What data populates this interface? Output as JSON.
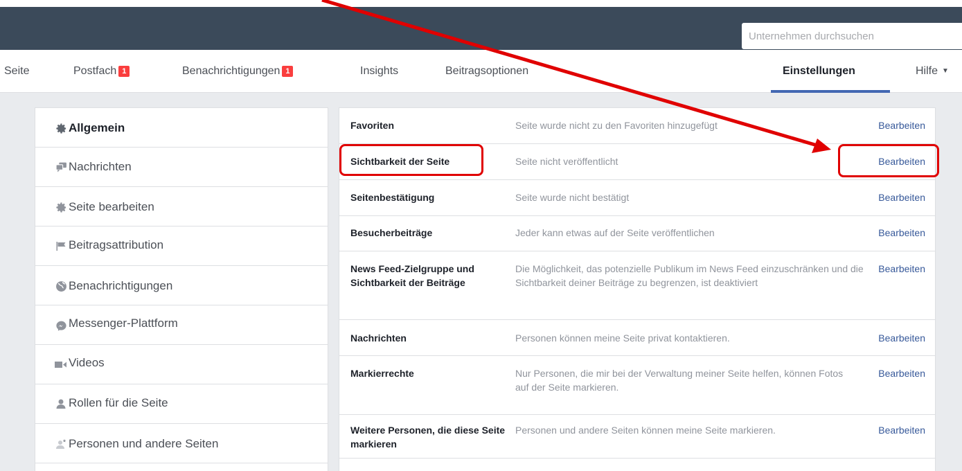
{
  "header": {
    "search_placeholder": "Unternehmen durchsuchen"
  },
  "nav": {
    "items": [
      {
        "label": "Seite"
      },
      {
        "label": "Postfach",
        "badge": "1"
      },
      {
        "label": "Benachrichtigungen",
        "badge": "1"
      },
      {
        "label": "Insights"
      },
      {
        "label": "Beitragsoptionen"
      },
      {
        "label": "Einstellungen",
        "active": true
      },
      {
        "label": "Hilfe"
      }
    ]
  },
  "sidebar": {
    "items": [
      {
        "label": "Allgemein",
        "icon": "gear-icon",
        "active": true
      },
      {
        "label": "Nachrichten",
        "icon": "chat-bubbles-icon"
      },
      {
        "label": "Seite bearbeiten",
        "icon": "gear-icon"
      },
      {
        "label": "Beitragsattribution",
        "icon": "flag-icon"
      },
      {
        "label": "Benachrichtigungen",
        "icon": "globe-icon"
      },
      {
        "label": "Messenger-Plattform",
        "icon": "messenger-icon"
      },
      {
        "label": "Videos",
        "icon": "video-camera-icon"
      },
      {
        "label": "Rollen für die Seite",
        "icon": "person-icon"
      },
      {
        "label": "Personen und andere Seiten",
        "icon": "person-star-icon"
      }
    ]
  },
  "settings": {
    "edit_label": "Bearbeiten",
    "rows": [
      {
        "title": "Favoriten",
        "desc": "Seite wurde nicht zu den Favoriten hinzugefügt"
      },
      {
        "title": "Sichtbarkeit der Seite",
        "desc": "Seite nicht veröffentlicht"
      },
      {
        "title": "Seitenbestätigung",
        "desc": "Seite wurde nicht bestätigt"
      },
      {
        "title": "Besucherbeiträge",
        "desc": "Jeder kann etwas auf der Seite veröffentlichen"
      },
      {
        "title": "News Feed-Zielgruppe und Sichtbarkeit der Beiträge",
        "desc": "Die Möglichkeit, das potenzielle Publikum im News Feed einzuschränken und die Sichtbarkeit deiner Beiträge zu begrenzen, ist deaktiviert"
      },
      {
        "title": "Nachrichten",
        "desc": "Personen können meine Seite privat kontaktieren."
      },
      {
        "title": "Markierrechte",
        "desc": "Nur Personen, die mir bei der Verwaltung meiner Seite helfen, können Fotos auf der Seite markieren."
      },
      {
        "title": "Weitere Personen, die diese Seite markieren",
        "desc": "Personen und andere Seiten können meine Seite markieren."
      }
    ]
  },
  "colors": {
    "header_bg": "#3b4a5a",
    "link": "#365899",
    "annotation": "#e00000",
    "badge": "#fa3e3e",
    "active_tab_underline": "#4267b2"
  }
}
